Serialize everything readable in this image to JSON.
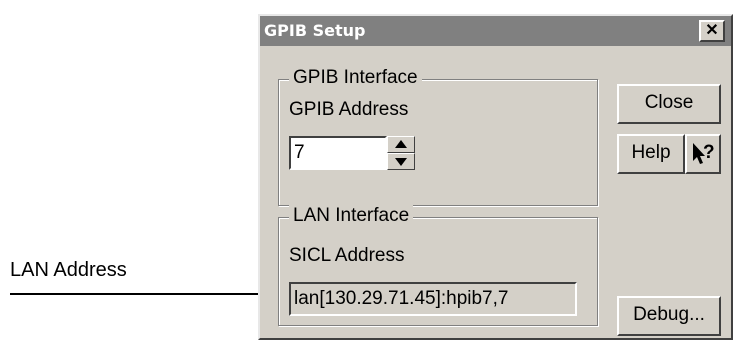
{
  "callout": {
    "label": "LAN Address"
  },
  "dialog": {
    "title": "GPIB Setup",
    "close_glyph": "✕"
  },
  "gpib_interface": {
    "legend": "GPIB Interface",
    "address_label": "GPIB Address",
    "address_value": "7"
  },
  "lan_interface": {
    "legend": "LAN Interface",
    "sicl_label": "SICL Address",
    "sicl_value": "lan[130.29.71.45]:hpib7,7"
  },
  "buttons": {
    "close": "Close",
    "help": "Help",
    "whats_this": "?",
    "debug": "Debug..."
  },
  "icons": {
    "spin_up": "triangle-up-icon",
    "spin_down": "triangle-down-icon",
    "whats_this": "arrow-question-icon"
  },
  "colors": {
    "titlebar": "#808080",
    "dialog_face": "#d4d0c8"
  }
}
